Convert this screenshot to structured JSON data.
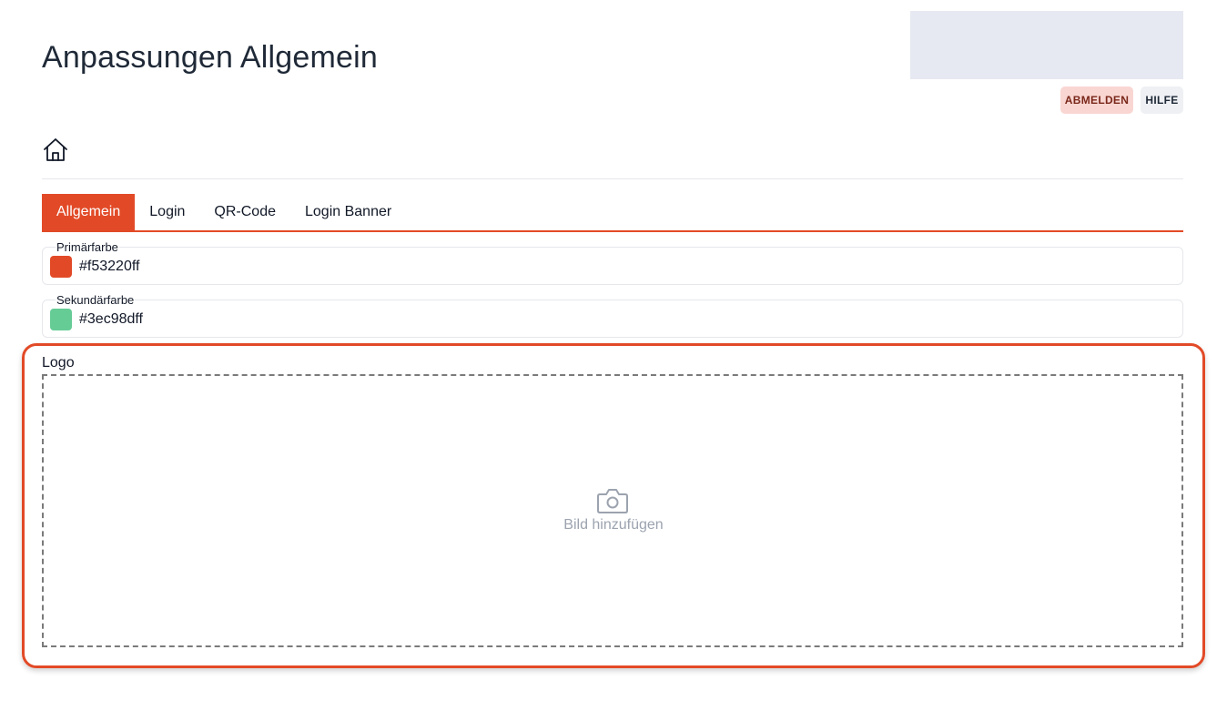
{
  "page": {
    "title": "Anpassungen Allgemein"
  },
  "header": {
    "logout_label": "ABMELDEN",
    "help_label": "HILFE"
  },
  "tabs": [
    "Allgemein",
    "Login",
    "QR-Code",
    "Login Banner"
  ],
  "active_tab": "Allgemein",
  "fields": {
    "primary": {
      "label": "Primärfarbe",
      "value": "#f53220ff",
      "color": "#e24a27"
    },
    "secondary": {
      "label": "Sekundärfarbe",
      "value": "#3ec98dff",
      "color": "#66cc96"
    }
  },
  "logo": {
    "label": "Logo",
    "upload_text": "Bild hinzufügen"
  },
  "icons": {
    "home": "home-icon",
    "camera": "camera-icon"
  },
  "colors": {
    "accent": "#e24a27",
    "logout_bg": "#f9d6d2",
    "help_bg": "#eef0f4"
  }
}
